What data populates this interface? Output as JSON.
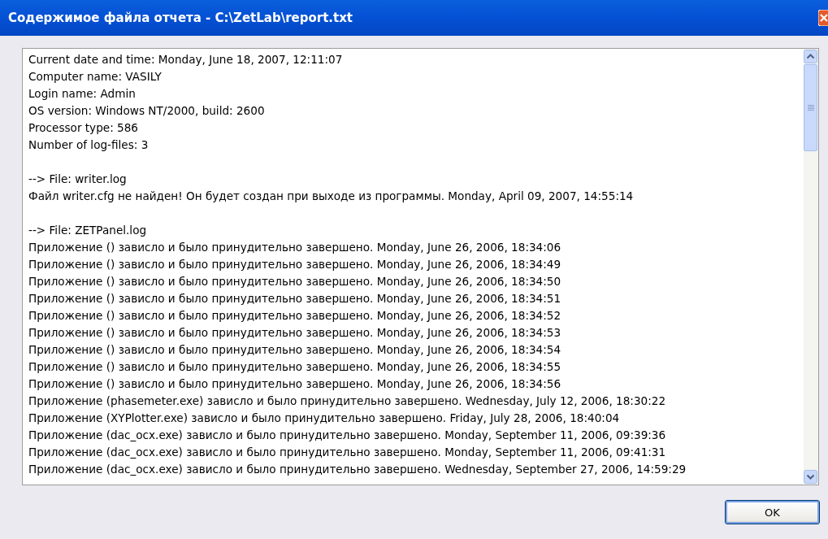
{
  "window": {
    "title": "Содержимое файла отчета - C:\\ZetLab\\report.txt"
  },
  "report": {
    "header_lines": [
      "Current date and time: Monday, June 18, 2007, 12:11:07",
      "Computer name: VASILY",
      "Login name: Admin",
      "OS version: Windows NT/2000, build: 2600",
      "Processor type: 586",
      "Number of log-files: 3"
    ],
    "files": [
      {
        "heading": "--> File: writer.log",
        "entries": [
          "Файл writer.cfg не найден! Он будет создан при выходе из программы. Monday, April 09, 2007, 14:55:14"
        ]
      },
      {
        "heading": "--> File: ZETPanel.log",
        "entries": [
          "Приложение () зависло и было принудительно завершено. Monday, June 26, 2006, 18:34:06",
          "Приложение () зависло и было принудительно завершено. Monday, June 26, 2006, 18:34:49",
          "Приложение () зависло и было принудительно завершено. Monday, June 26, 2006, 18:34:50",
          "Приложение () зависло и было принудительно завершено. Monday, June 26, 2006, 18:34:51",
          "Приложение () зависло и было принудительно завершено. Monday, June 26, 2006, 18:34:52",
          "Приложение () зависло и было принудительно завершено. Monday, June 26, 2006, 18:34:53",
          "Приложение () зависло и было принудительно завершено. Monday, June 26, 2006, 18:34:54",
          "Приложение () зависло и было принудительно завершено. Monday, June 26, 2006, 18:34:55",
          "Приложение () зависло и было принудительно завершено. Monday, June 26, 2006, 18:34:56",
          "Приложение (phasemeter.exe) зависло и было принудительно завершено. Wednesday, July 12, 2006, 18:30:22",
          "Приложение (XYPlotter.exe) зависло и было принудительно завершено. Friday, July 28, 2006, 18:40:04",
          "Приложение (dac_ocx.exe) зависло и было принудительно завершено. Monday, September 11, 2006, 09:39:36",
          "Приложение (dac_ocx.exe) зависло и было принудительно завершено. Monday, September 11, 2006, 09:41:31",
          "Приложение (dac_ocx.exe) зависло и было принудительно завершено. Wednesday, September 27, 2006, 14:59:29"
        ]
      }
    ]
  },
  "buttons": [
    {
      "label": "OK",
      "kind": "default"
    }
  ]
}
